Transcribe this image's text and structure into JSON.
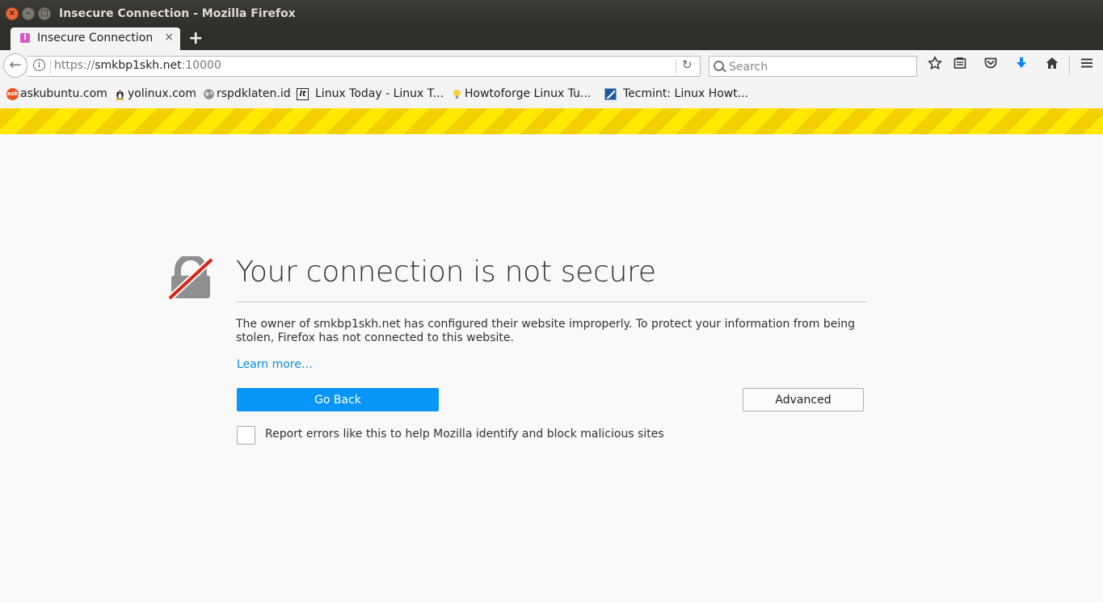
{
  "window": {
    "title": "Insecure Connection - Mozilla Firefox",
    "close_glyph": "×",
    "minimize_glyph": "–",
    "maximize_glyph": "□"
  },
  "tab": {
    "label": "Insecure Connection",
    "favicon_glyph": "!",
    "close_glyph": "×",
    "new_tab_glyph": "+"
  },
  "navbar": {
    "back_glyph": "←",
    "url_scheme": "https://",
    "url_host": "smkbp1skh.net",
    "url_port": ":10000",
    "reload_glyph": "↻",
    "info_glyph": "i",
    "search_placeholder": "Search",
    "toolbar_icons": [
      "bookmark-star-icon",
      "reading-list-icon",
      "pocket-icon",
      "downloads-icon",
      "home-icon",
      "menu-icon"
    ]
  },
  "bookmarks": [
    {
      "label": "askubuntu.com",
      "icon": "askubuntu-icon"
    },
    {
      "label": "yolinux.com",
      "icon": "tux-icon"
    },
    {
      "label": "rspdklaten.id",
      "icon": "globe-icon"
    },
    {
      "label": "Linux Today - Linux T...",
      "icon": "linuxtoday-icon"
    },
    {
      "label": "Howtoforge Linux Tu...",
      "icon": "lightbulb-icon"
    },
    {
      "label": "Tecmint: Linux Howt...",
      "icon": "tecmint-icon"
    }
  ],
  "error": {
    "title": "Your connection is not secure",
    "description": "The owner of smkbp1skh.net has configured their website improperly. To protect your information from being stolen, Firefox has not connected to this website.",
    "learn_more": "Learn more…",
    "go_back": "Go Back",
    "advanced": "Advanced",
    "report_label": "Report errors like this to help Mozilla identify and block malicious sites",
    "report_checked": false
  },
  "colors": {
    "accent": "#0996f8",
    "link": "#0a8dd8",
    "stripe_yellow": "#ffe900",
    "stripe_dark": "#f2d000",
    "lock_gray": "#8f8f8f",
    "slash_red": "#d92215"
  }
}
